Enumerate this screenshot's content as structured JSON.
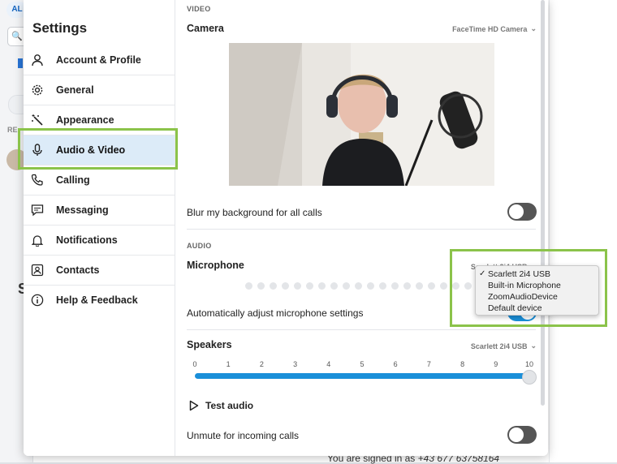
{
  "background_app": {
    "profile_initials": "AL",
    "recents_label": "RE",
    "section_letter": "S",
    "signed_in_text": "You are signed in as",
    "signed_in_number": "+43 677 63758164"
  },
  "sidebar": {
    "title": "Settings",
    "items": [
      {
        "label": "Account & Profile",
        "icon": "person-icon"
      },
      {
        "label": "General",
        "icon": "gear-icon"
      },
      {
        "label": "Appearance",
        "icon": "magic-wand-icon"
      },
      {
        "label": "Audio & Video",
        "icon": "microphone-icon",
        "active": true
      },
      {
        "label": "Calling",
        "icon": "phone-icon"
      },
      {
        "label": "Messaging",
        "icon": "chat-bubble-icon"
      },
      {
        "label": "Notifications",
        "icon": "bell-icon"
      },
      {
        "label": "Contacts",
        "icon": "contact-card-icon"
      },
      {
        "label": "Help & Feedback",
        "icon": "info-icon"
      }
    ]
  },
  "video": {
    "section_label": "VIDEO",
    "camera_label": "Camera",
    "camera_device": "FaceTime HD Camera",
    "blur_label": "Blur my background for all calls",
    "blur_enabled": false
  },
  "audio": {
    "section_label": "AUDIO",
    "microphone_label": "Microphone",
    "microphone_device": "Scarlett 2i4 USB",
    "microphone_options": [
      "Scarlett 2i4 USB",
      "Built-in Microphone",
      "ZoomAudioDevice",
      "Default device"
    ],
    "microphone_selected_index": 0,
    "auto_adjust_label": "Automatically adjust microphone settings",
    "auto_adjust_enabled": true,
    "speakers_label": "Speakers",
    "speakers_device": "Scarlett 2i4 USB",
    "volume_scale": [
      "0",
      "1",
      "2",
      "3",
      "4",
      "5",
      "6",
      "7",
      "8",
      "9",
      "10"
    ],
    "volume_value": 10,
    "test_audio_label": "Test audio",
    "unmute_label": "Unmute for incoming calls",
    "unmute_enabled": false
  },
  "colors": {
    "accent": "#1a8fd9",
    "highlight_box": "#8bc34a",
    "active_nav_bg": "#dcebf8"
  }
}
